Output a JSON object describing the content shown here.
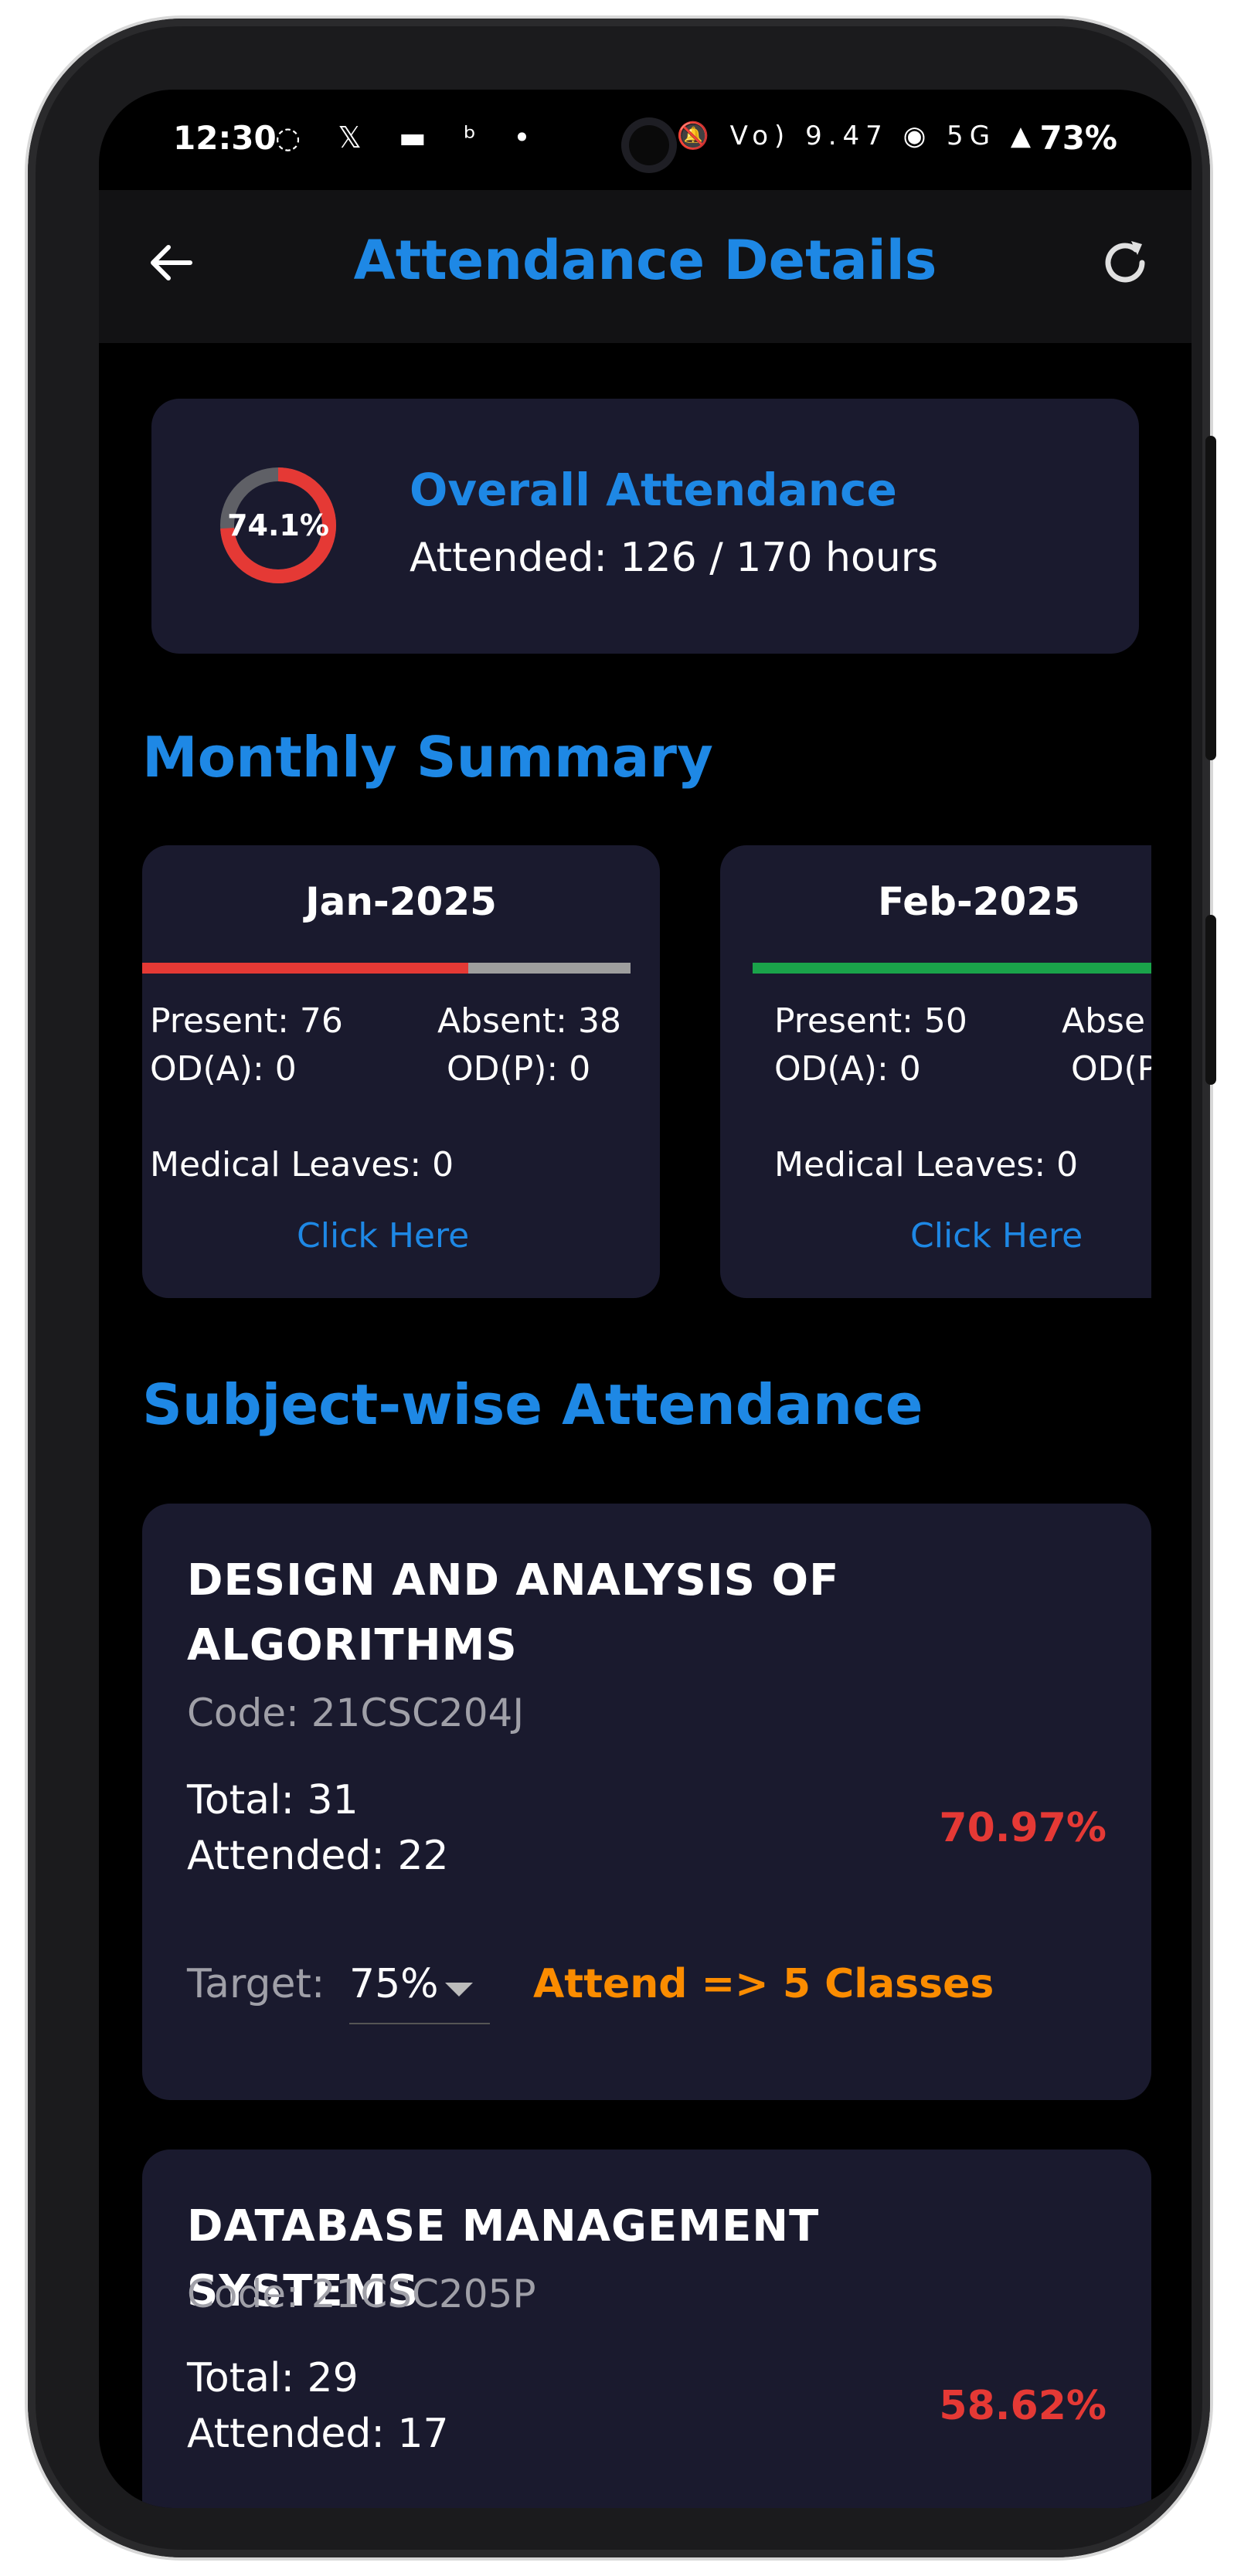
{
  "status_bar": {
    "time": "12:30",
    "left_icons": "◌ 𝕏 ▬ ᵇ •",
    "right_icons": "🔕 Vo) 9.47 ◉ 5G ▲",
    "battery": "73%"
  },
  "app_bar": {
    "title": "Attendance Details",
    "back_icon": "arrow-left-icon",
    "refresh_icon": "refresh-icon"
  },
  "overall": {
    "percent_label": "74.1%",
    "percent_value": 0.741,
    "title": "Overall Attendance",
    "attended_text": "Attended: 126 / 170 hours"
  },
  "monthly_summary": {
    "title": "Monthly Summary",
    "months": [
      {
        "month": "Jan-2025",
        "present": "Present: 76",
        "absent": "Absent: 38",
        "od_a": "OD(A): 0",
        "od_p": "OD(P): 0",
        "medical": "Medical Leaves: 0",
        "link": "Click Here",
        "present_fraction": 0.667,
        "bar_color": "#e53935"
      },
      {
        "month": "Feb-2025",
        "present": "Present: 50",
        "absent": "Abse",
        "od_a": "OD(A): 0",
        "od_p": "OD(P",
        "medical": "Medical Leaves: 0",
        "link": "Click Here",
        "present_fraction": 1.0,
        "bar_color": "#1aa34a"
      }
    ]
  },
  "subject_wise": {
    "title": "Subject-wise Attendance",
    "subjects": [
      {
        "name": "DESIGN AND ANALYSIS OF ALGORITHMS",
        "code": "Code: 21CSC204J",
        "total": "Total: 31",
        "attended": "Attended: 22",
        "percent": "70.97%",
        "target_label": "Target:",
        "target_value": "75%",
        "advice": "Attend => 5 Classes"
      },
      {
        "name": "DATABASE MANAGEMENT SYSTEMS",
        "code": "Code: 21CSC205P",
        "total": "Total: 29",
        "attended": "Attended: 17",
        "percent": "58.62%"
      }
    ]
  },
  "colors": {
    "accent": "#1e88e5",
    "card": "#1a1a2e",
    "danger": "#e53935",
    "warning": "#fb8c00",
    "success": "#1aa34a"
  }
}
